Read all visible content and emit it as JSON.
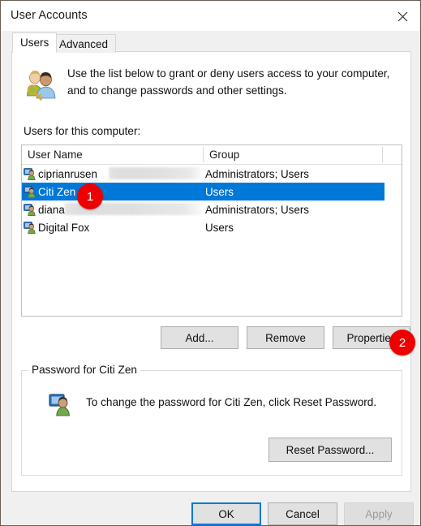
{
  "window": {
    "title": "User Accounts",
    "close_icon": "close-icon"
  },
  "tabs": [
    {
      "label": "Users",
      "active": true
    },
    {
      "label": "Advanced",
      "active": false
    }
  ],
  "intro": {
    "icon": "users-key-icon",
    "text": "Use the list below to grant or deny users access to your computer, and to change passwords and other settings."
  },
  "users_section": {
    "label": "Users for this computer:",
    "columns": [
      "User Name",
      "Group"
    ],
    "rows": [
      {
        "icon": "user-icon",
        "name": "ciprianrusen",
        "group": "Administrators; Users",
        "selected": false,
        "redacted": true
      },
      {
        "icon": "user-icon",
        "name": "Citi Zen",
        "group": "Users",
        "selected": true,
        "redacted": false
      },
      {
        "icon": "user-icon",
        "name": "diana",
        "group": "Administrators; Users",
        "selected": false,
        "redacted": true
      },
      {
        "icon": "user-icon",
        "name": "Digital Fox",
        "group": "Users",
        "selected": false,
        "redacted": false
      }
    ]
  },
  "list_buttons": {
    "add": "Add...",
    "remove": "Remove",
    "properties": "Properties"
  },
  "password_group": {
    "title": "Password for Citi Zen",
    "icon": "single-user-icon",
    "text": "To change the password for Citi Zen, click Reset Password.",
    "reset_button": "Reset Password..."
  },
  "footer": {
    "ok": "OK",
    "cancel": "Cancel",
    "apply": "Apply",
    "apply_disabled": true
  },
  "callouts": [
    {
      "number": "1",
      "target": "selected-user-row"
    },
    {
      "number": "2",
      "target": "properties-button"
    }
  ],
  "colors": {
    "selection_blue": "#0078d7",
    "badge_red": "#ee0000",
    "button_face": "#e1e1e1",
    "dialog_face": "#f0f0f0",
    "disabled_text": "#9a9a9a"
  }
}
